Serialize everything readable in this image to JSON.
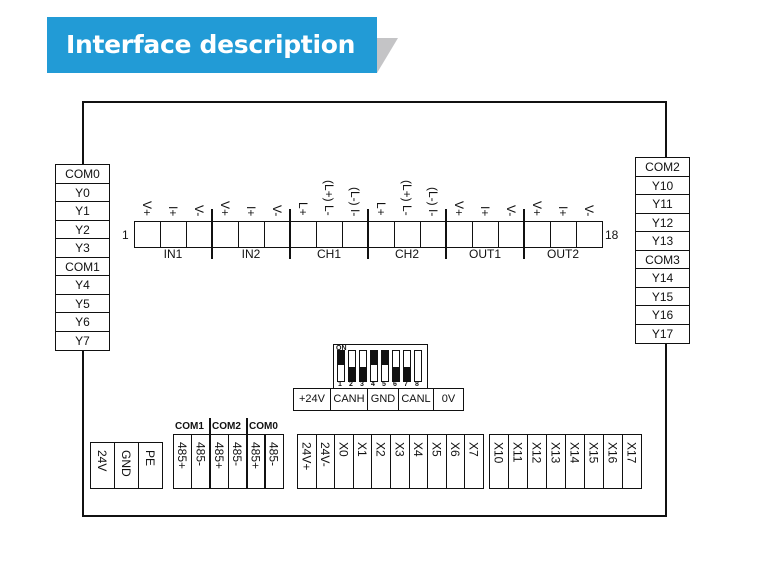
{
  "header": {
    "title": "Interface description",
    "accent": "#229bd6"
  },
  "left_terminal": [
    "COM0",
    "Y0",
    "Y1",
    "Y2",
    "Y3",
    "COM1",
    "Y4",
    "Y5",
    "Y6",
    "Y7"
  ],
  "right_terminal": [
    "COM2",
    "Y10",
    "Y11",
    "Y12",
    "Y13",
    "COM3",
    "Y14",
    "Y15",
    "Y16",
    "Y17"
  ],
  "top_terminal": {
    "start_label": "1",
    "end_label": "18",
    "pin_labels": [
      "V+",
      "I+",
      "V-",
      "V+",
      "I+",
      "V-",
      "L+",
      "(L+) L-",
      "(L-) I-",
      "L+",
      "(L+) L-",
      "(L-) I-",
      "V+",
      "I+",
      "V-",
      "V+",
      "I+",
      "V-"
    ],
    "groups": [
      "IN1",
      "IN2",
      "CH1",
      "CH2",
      "OUT1",
      "OUT2"
    ]
  },
  "dip_switch": {
    "label": "ON",
    "numbers": [
      "1",
      "2",
      "3",
      "4",
      "5",
      "6",
      "7",
      "8"
    ],
    "states": [
      "on",
      "off",
      "off",
      "on",
      "on",
      "off",
      "off",
      "none"
    ]
  },
  "can_terminal": [
    "+24V",
    "CANH",
    "GND",
    "CANL",
    "0V"
  ],
  "power_terminal": [
    "24V",
    "GND",
    "PE"
  ],
  "rs485_terminal": {
    "coms": [
      "COM1",
      "COM2",
      "COM0"
    ],
    "pins": [
      "485+",
      "485-",
      "485+",
      "485-",
      "485+",
      "485-"
    ]
  },
  "input_terminal_1": [
    "24V+",
    "24V-",
    "X0",
    "X1",
    "X2",
    "X3",
    "X4",
    "X5",
    "X6",
    "X7"
  ],
  "input_terminal_2": [
    "X10",
    "X11",
    "X12",
    "X13",
    "X14",
    "X15",
    "X16",
    "X17"
  ]
}
